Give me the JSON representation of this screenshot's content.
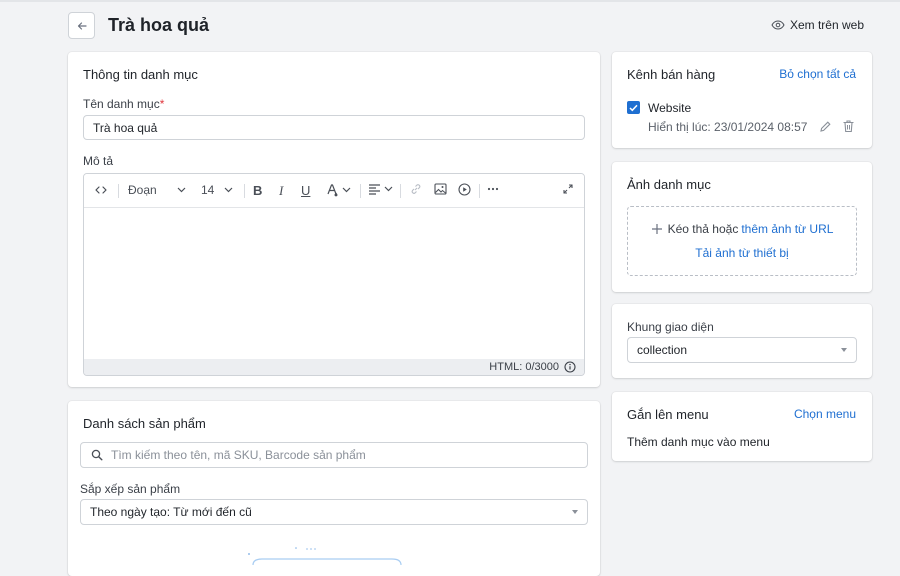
{
  "header": {
    "title": "Trà hoa quả",
    "view_web_label": "Xem trên web"
  },
  "category_info": {
    "title": "Thông tin danh mục",
    "name_label": "Tên danh mục",
    "required_mark": "*",
    "name_value": "Trà hoa quả",
    "description_label": "Mô tả",
    "editor": {
      "paragraph_format": "Đoạn",
      "font_size": "14",
      "footer_text": "HTML: 0/3000"
    }
  },
  "product_list": {
    "title": "Danh sách sản phẩm",
    "search_placeholder": "Tìm kiếm theo tên, mã SKU, Barcode sản phẩm",
    "sort_label": "Sắp xếp sản phẩm",
    "sort_value": "Theo ngày tạo: Từ mới đến cũ"
  },
  "sales_channel": {
    "title": "Kênh bán hàng",
    "deselect_all": "Bỏ chọn tất cả",
    "channel_name": "Website",
    "display_time": "Hiển thị lúc: 23/01/2024 08:57"
  },
  "category_image": {
    "title": "Ảnh danh mục",
    "drag_text": "Kéo thả hoặc",
    "add_url_link": "thêm ảnh từ URL",
    "upload_link": "Tải ảnh từ thiết bị"
  },
  "template": {
    "label": "Khung giao diện",
    "value": "collection"
  },
  "menu": {
    "title": "Gắn lên menu",
    "choose_link": "Chọn menu",
    "description": "Thêm danh mục vào menu"
  },
  "colors": {
    "accent": "#1f6fd1",
    "background": "#f2f3f5",
    "required": "#e0363c"
  }
}
